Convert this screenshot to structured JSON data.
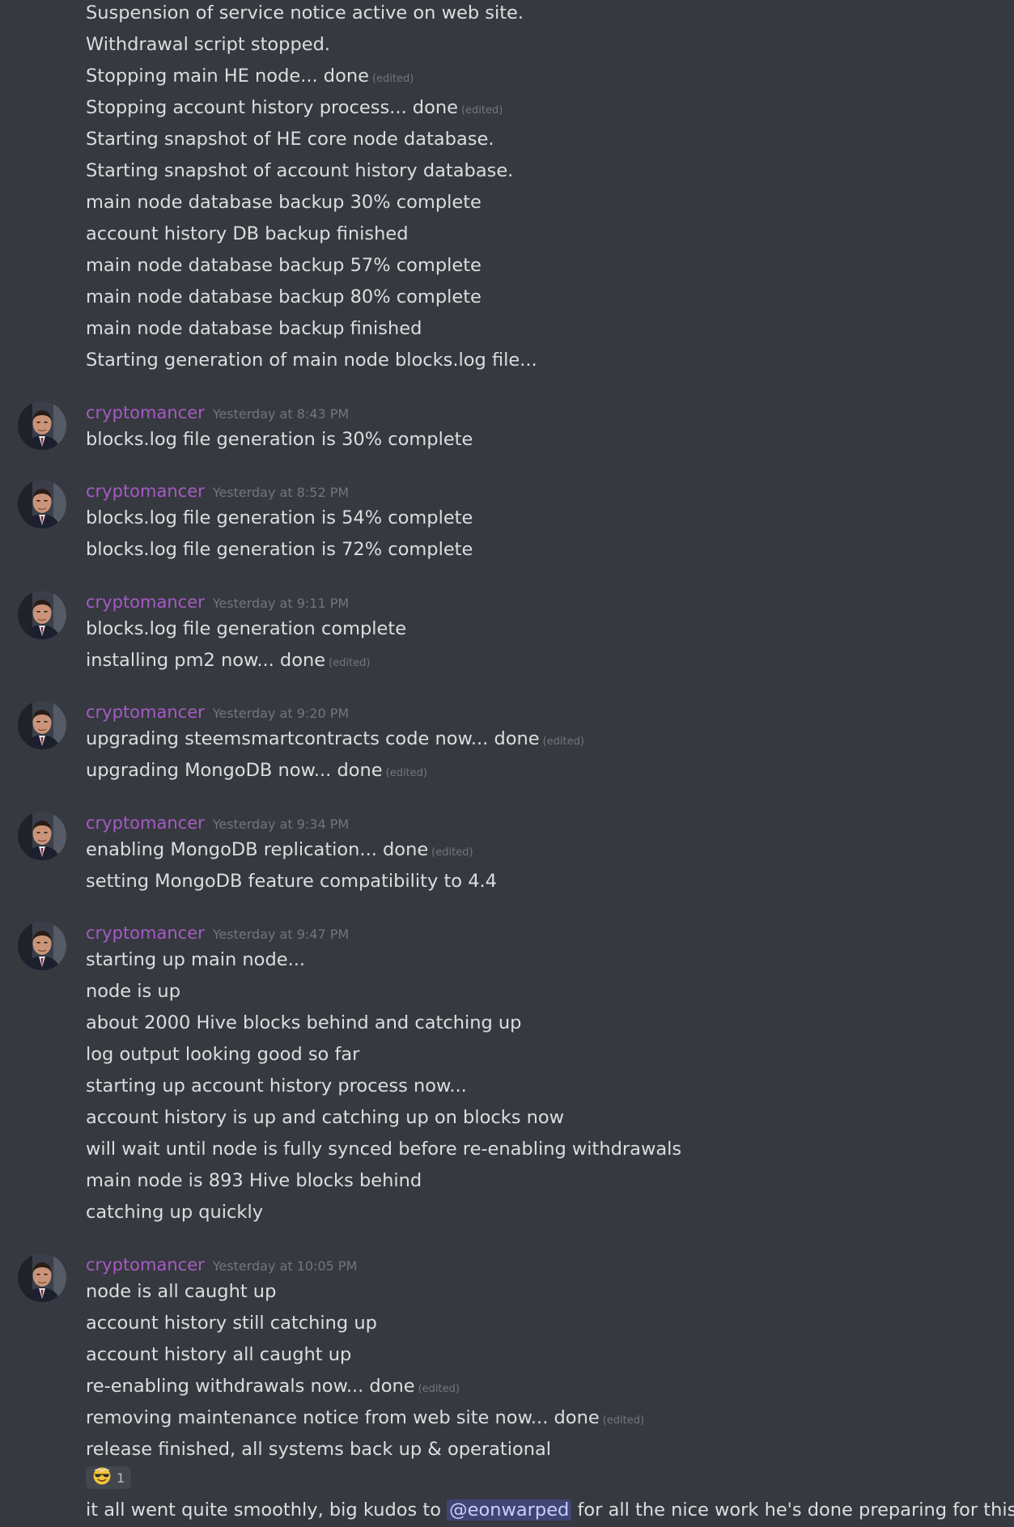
{
  "username": "cryptomancer",
  "edited_tag": "(edited)",
  "continuation": [
    "Suspension of service notice active on web site.",
    "Withdrawal script stopped.",
    "Stopping main HE node...  done",
    "Stopping account history process...  done",
    "Starting snapshot of HE core node database.",
    "Starting snapshot of account history database.",
    "main node database backup 30% complete",
    "account history DB backup finished",
    "main node database backup 57% complete",
    "main node database backup 80% complete",
    "main node database backup finished",
    "Starting generation of main node blocks.log file..."
  ],
  "groups": [
    {
      "time": "Yesterday at 8:43 PM",
      "lines": [
        "blocks.log file generation is 30% complete"
      ]
    },
    {
      "time": "Yesterday at 8:52 PM",
      "lines": [
        "blocks.log file generation is 54% complete",
        "blocks.log file generation is 72% complete"
      ]
    },
    {
      "time": "Yesterday at 9:11 PM",
      "lines": [
        "blocks.log file generation complete",
        "installing pm2 now...  done"
      ]
    },
    {
      "time": "Yesterday at 9:20 PM",
      "lines": [
        "upgrading steemsmartcontracts code now... done",
        "upgrading MongoDB now...  done"
      ]
    },
    {
      "time": "Yesterday at 9:34 PM",
      "lines": [
        "enabling MongoDB replication...  done",
        "setting MongoDB feature compatibility to 4.4"
      ]
    },
    {
      "time": "Yesterday at 9:47 PM",
      "lines": [
        "starting up main node...",
        "node is up",
        "about 2000 Hive blocks behind and catching up",
        "log output looking good so far",
        "starting up account history process now...",
        "account history is up and catching up on blocks now",
        "will wait until node is fully synced before re-enabling withdrawals",
        "main node is 893 Hive blocks behind",
        "catching up quickly"
      ]
    },
    {
      "time": "Yesterday at 10:05 PM",
      "lines": [
        "node is all caught up",
        "account history still catching up",
        "account history all caught up",
        "re-enabling withdrawals now...  done",
        "removing maintenance notice from web site now...  done",
        "release finished, all systems back up & operational"
      ]
    }
  ],
  "reaction": {
    "emoji": "sunglasses-emoji",
    "count": "1"
  },
  "final_message": {
    "before": "it all went quite smoothly, big kudos to ",
    "mention": "@eonwarped",
    "after": " for all the nice work he's done preparing for this upgrade!"
  }
}
